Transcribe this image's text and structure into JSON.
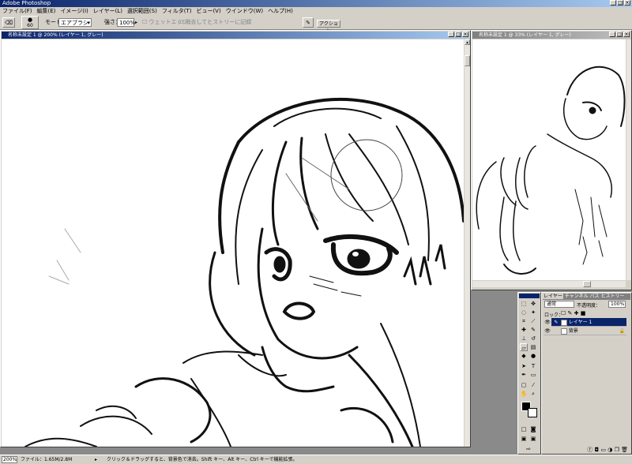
{
  "app": {
    "title": "Adobe Photoshop"
  },
  "menu": [
    "ファイル(F)",
    "編集(E)",
    "イメージ(I)",
    "レイヤー(L)",
    "選択範囲(S)",
    "フィルタ(T)",
    "ビュー(V)",
    "ウインドウ(W)",
    "ヘルプ(H)"
  ],
  "options": {
    "brush_size": "60",
    "mode_label": "モード：",
    "mode_value": "エアブラシ",
    "strength_label": "強さ：",
    "strength_value": "100%",
    "wet_edges": "ウェットエッジ",
    "history_erase": "消去してヒストリーに記録",
    "palette_tab": "ブラシ",
    "palette_tab2": "アクション"
  },
  "document": {
    "title": "名称未設定 1 @ 200% (レイヤー 1, グレー)"
  },
  "navigator": {
    "title": "名称未設定 1 @ 33% (レイヤー 1, グレー)"
  },
  "layers_panel": {
    "tabs": [
      "レイヤー",
      "チャンネル",
      "パス",
      "ヒストリー"
    ],
    "blend_mode": "通常",
    "opacity_label": "不透明度：",
    "opacity_value": "100%",
    "lock_label": "ロック：",
    "layers": [
      {
        "name": "レイヤー 1",
        "selected": true
      },
      {
        "name": "背景",
        "selected": false
      }
    ]
  },
  "status": {
    "zoom": "200%",
    "file_info": "ファイル：1.65M/2.8M",
    "hint": "クリック＆ドラッグすると、背景色で消去。Shift キー、Alt キー、Ctrl キーで機能拡張。"
  },
  "colors": {
    "title_active": "#0a246a",
    "title_gradient": "#a6caf0",
    "chrome": "#d4d0c8",
    "workspace": "#8a8a8a"
  }
}
